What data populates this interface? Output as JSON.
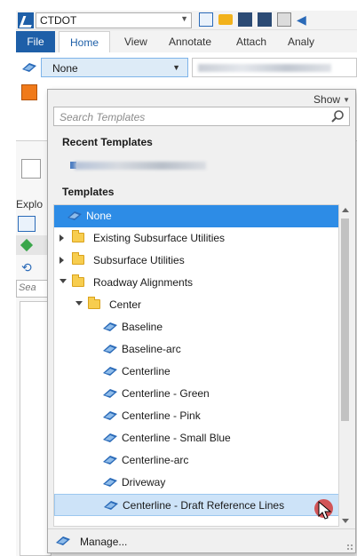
{
  "app": {
    "workspace": "CTDOT",
    "tabs": [
      "File",
      "Home",
      "View",
      "Annotate",
      "Attach",
      "Analy"
    ],
    "level_value": "None"
  },
  "left_panel": {
    "explorer_label": "Explo",
    "search_placeholder": "Sea"
  },
  "picker": {
    "show_label": "Show",
    "search_placeholder": "Search Templates",
    "recent_heading": "Recent Templates",
    "templates_heading": "Templates",
    "manage_label": "Manage...",
    "tree": [
      {
        "label": "None",
        "kind": "template",
        "depth": 0,
        "selected": true
      },
      {
        "label": "Existing Subsurface Utilities",
        "kind": "folder",
        "depth": 0,
        "expanded": false
      },
      {
        "label": "Subsurface Utilities",
        "kind": "folder",
        "depth": 0,
        "expanded": false
      },
      {
        "label": "Roadway Alignments",
        "kind": "folder",
        "depth": 0,
        "expanded": true
      },
      {
        "label": "Center",
        "kind": "folder",
        "depth": 1,
        "expanded": true
      },
      {
        "label": "Baseline",
        "kind": "template",
        "depth": 2
      },
      {
        "label": "Baseline-arc",
        "kind": "template",
        "depth": 2
      },
      {
        "label": "Centerline",
        "kind": "template",
        "depth": 2
      },
      {
        "label": "Centerline - Green",
        "kind": "template",
        "depth": 2
      },
      {
        "label": "Centerline - Pink",
        "kind": "template",
        "depth": 2
      },
      {
        "label": "Centerline - Small Blue",
        "kind": "template",
        "depth": 2
      },
      {
        "label": "Centerline-arc",
        "kind": "template",
        "depth": 2
      },
      {
        "label": "Driveway",
        "kind": "template",
        "depth": 2
      },
      {
        "label": "Centerline - Draft Reference Lines",
        "kind": "template",
        "depth": 2,
        "hovered": true
      }
    ]
  },
  "colors": {
    "selection": "#2d8ce6",
    "hover": "#cde3f8",
    "file_tab": "#1e5fa8",
    "folder": "#f7cd4f"
  }
}
